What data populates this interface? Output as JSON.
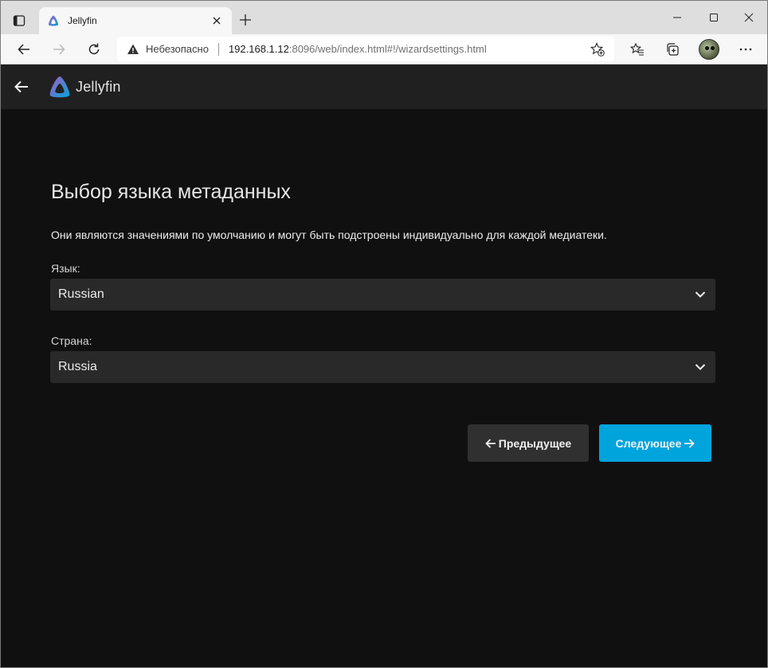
{
  "browser": {
    "tab": {
      "title": "Jellyfin"
    },
    "address": {
      "security_label": "Небезопасно",
      "host": "192.168.1.12",
      "rest": ":8096/web/index.html#!/wizardsettings.html"
    },
    "icons": [
      "tab-actions-icon",
      "jellyfin-favicon-icon",
      "close-icon",
      "plus-icon",
      "minimize-icon",
      "maximize-icon",
      "close-window-icon",
      "back-arrow-icon",
      "forward-arrow-icon",
      "refresh-icon",
      "warning-icon",
      "add-favorite-icon",
      "favorites-icon",
      "collections-icon",
      "profile-avatar",
      "more-icon"
    ]
  },
  "app": {
    "brand_name": "Jellyfin",
    "page": {
      "title": "Выбор языка метаданных",
      "description": "Они являются значениями по умолчанию и могут быть подстроены индивидуально для каждой медиатеки.",
      "language": {
        "label": "Язык:",
        "value": "Russian"
      },
      "country": {
        "label": "Страна:",
        "value": "Russia"
      },
      "buttons": {
        "prev": "Предыдущее",
        "next": "Следующее"
      }
    }
  },
  "colors": {
    "accent": "#00a4dc",
    "background": "#101010",
    "header": "#202020",
    "field": "#292929"
  }
}
